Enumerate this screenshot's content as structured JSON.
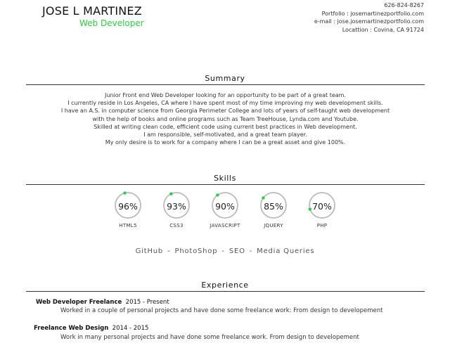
{
  "header": {
    "name": "JOSE L MARTINEZ",
    "role": "Web Developer",
    "phone": "626-824-8267",
    "portfolio": "Portfolio : josemartinezportfolio.com",
    "email": "e-mail : jose.josemartinezportfolio.com",
    "location": "Locattion : Covina, CA 91724"
  },
  "summary": {
    "title": "Summary",
    "lines": [
      "Junior Front end Web Developer looking for an opportunity to be part of a great team.",
      "I currently reside in Los Angeles, CA where I have spent most of my time improving my web development skills.",
      "I have an A.S. in computer science from Georgia Perimeter College and lots of years of self-taught web development",
      "with the help of books and online programs such as Team TreeHouse, Lynda.com and Youtube.",
      "Skilled at writing clean code, efficient code using current best practices in Web development.",
      "I am responsible, self-motivated, and a great team player.",
      "My only desire is to work for a company where I can be a great asset and give 100%."
    ]
  },
  "skills": {
    "title": "Skills",
    "accent_color": "#2ecc40",
    "ring_color": "#bbbbbb",
    "items": [
      {
        "percent": "96%",
        "level": 0.96,
        "label": "HTML5"
      },
      {
        "percent": "93%",
        "level": 0.93,
        "label": "CSS3"
      },
      {
        "percent": "90%",
        "level": 0.9,
        "label": "JAVASCRIPT"
      },
      {
        "percent": "85%",
        "level": 0.85,
        "label": "JQUERY"
      },
      {
        "percent": "70%",
        "level": 0.7,
        "label": "PHP"
      }
    ],
    "tools": [
      "GitHub",
      "PhotoShop",
      "SEO",
      "Media Queries"
    ],
    "tools_separator": "-"
  },
  "experience": {
    "title": "Experience",
    "items": [
      {
        "role": "Web Developer Freelance",
        "dates": "2015 - Present",
        "description": "Worked in a couple of personal projects and have done some freelance work: From design to developement"
      },
      {
        "role": "Freelance Web Design",
        "dates": "2014 - 2015",
        "description": "Work in many personal projects and have done some freelance work. From design to developement"
      }
    ]
  }
}
